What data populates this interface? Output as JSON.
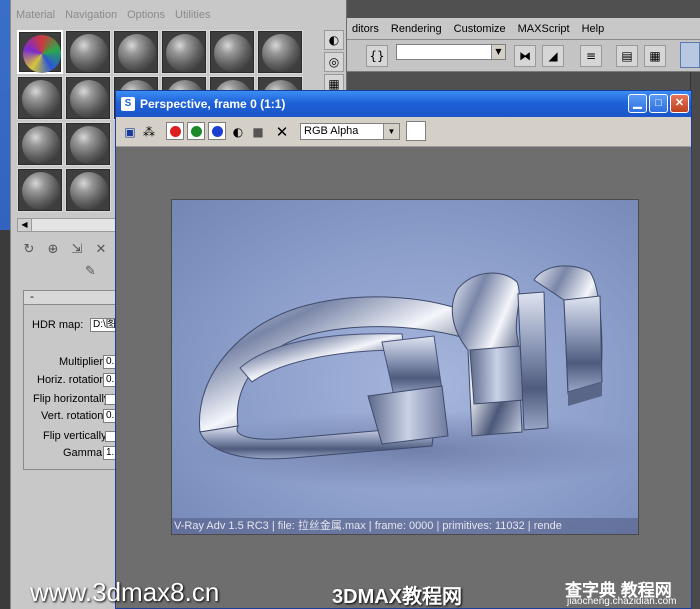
{
  "max_menu": [
    "ditors",
    "Rendering",
    "Customize",
    "MAXScript",
    "Help"
  ],
  "max_toolbar": {
    "named_selection": ""
  },
  "mat_editor": {
    "menu": [
      "Material",
      "Navigation",
      "Options",
      "Utilities"
    ],
    "hdr": {
      "rollout_label": "-",
      "hdr_map_label": "HDR map:",
      "hdr_map_value": "D:\\图",
      "multiplier_label": "Multiplier:",
      "multiplier_value": "0.",
      "horiz_rotation_label": "Horiz. rotation:",
      "horiz_rotation_value": "0.",
      "flip_h_label": "Flip horizontally",
      "vert_rotation_label": "Vert. rotation:",
      "vert_rotation_value": "0.",
      "flip_v_label": "Flip vertically",
      "gamma_label": "Gamma:",
      "gamma_value": "1."
    }
  },
  "frame_buffer": {
    "title": "Perspective, frame 0 (1:1)",
    "channel": "RGB Alpha",
    "channel_colors": {
      "red": "#dd1f1f",
      "green": "#1a8a2a",
      "blue": "#1b3fd1"
    },
    "status_line": "V-Ray Adv 1.5 RC3 | file: 拉丝金属.max | frame: 0000 | primitives: 11032 | rende"
  },
  "watermarks": {
    "left": "www.3dmax8.cn",
    "mid": "3DMAX教程网",
    "right": "查字典 教程网",
    "right_sub": "jiaocheng.chazidian.com"
  }
}
